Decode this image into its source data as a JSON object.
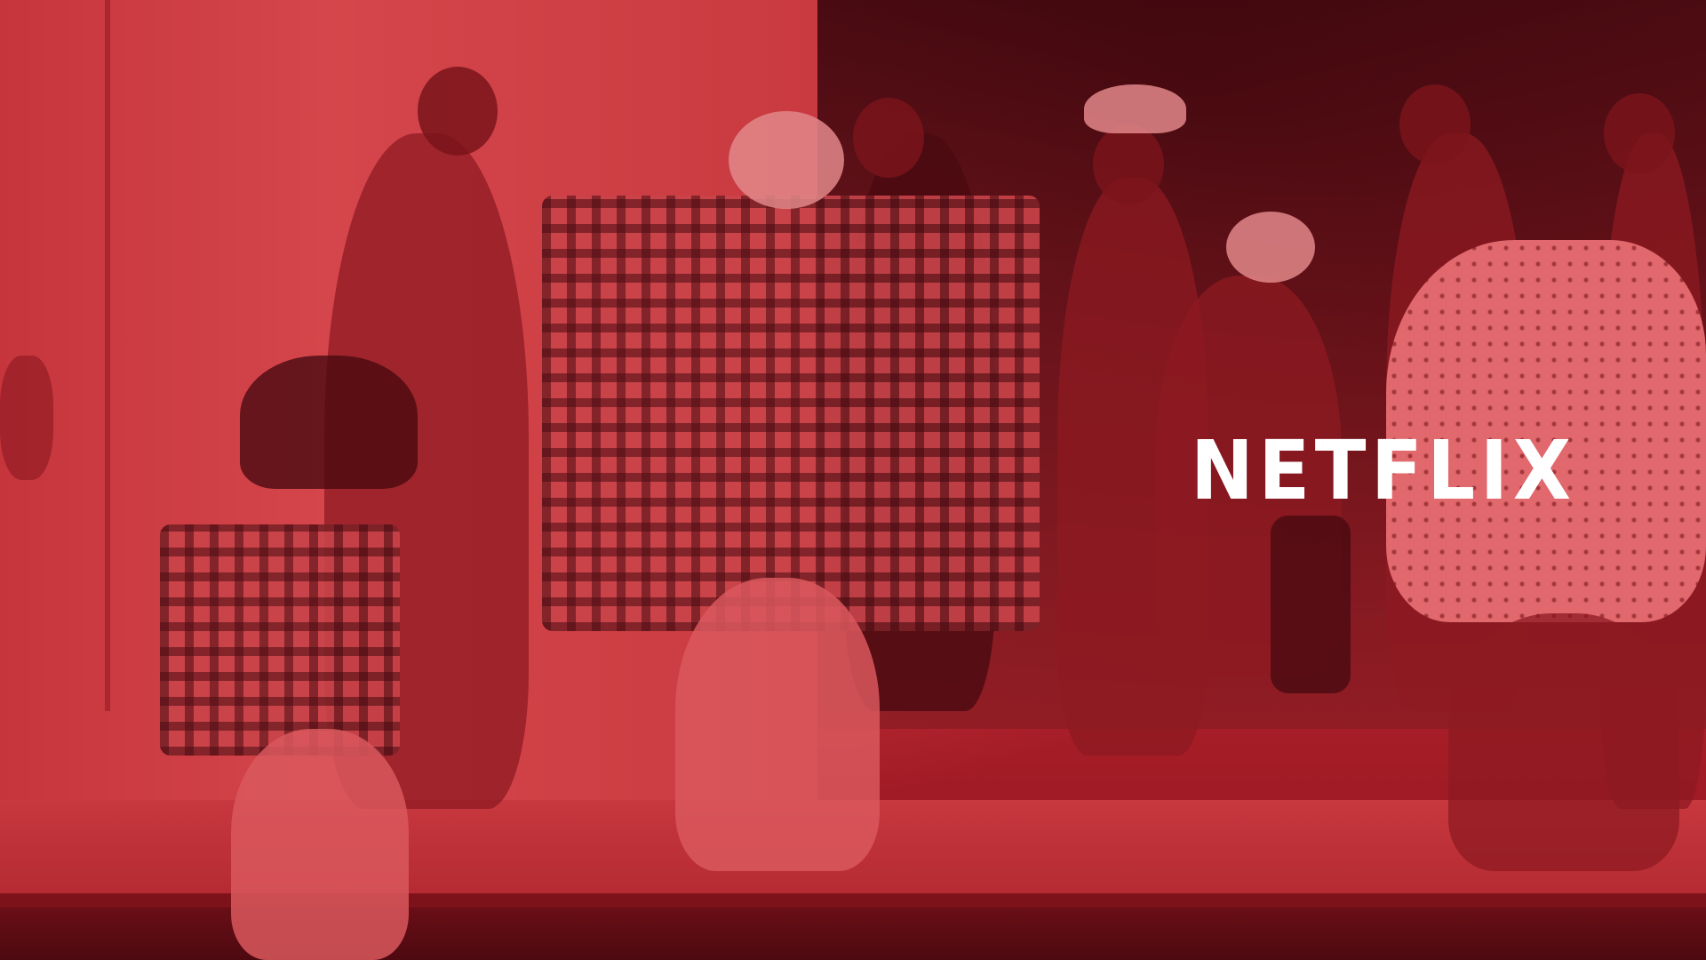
{
  "logo": {
    "text": "NETFLIX",
    "color": "#ffffff"
  },
  "scene": {
    "tint_color": "#c22f37",
    "shadow_color": "#3b070d"
  }
}
